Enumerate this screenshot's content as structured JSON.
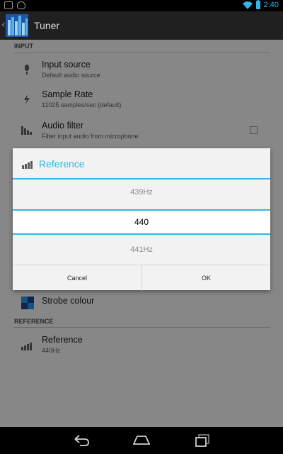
{
  "status_bar": {
    "time": "2:40",
    "icons": [
      "image-icon",
      "cat-notification-icon",
      "wifi-icon",
      "battery-icon"
    ]
  },
  "action_bar": {
    "title": "Tuner",
    "icons": [
      "back-chevron-icon",
      "app-logo-icon"
    ]
  },
  "settings": {
    "section_input": "INPUT",
    "input_source": {
      "title": "Input source",
      "summary": "Default audio source"
    },
    "sample_rate": {
      "title": "Sample Rate",
      "summary": "11025 samples/sec (default)"
    },
    "audio_filter": {
      "title": "Audio filter",
      "summary": "Filter input audio from microphone",
      "checked": false
    },
    "strobe_colour": {
      "title": "Strobe colour"
    },
    "section_reference": "REFERENCE",
    "reference": {
      "title": "Reference",
      "summary": "440Hz"
    }
  },
  "dialog": {
    "title": "Reference",
    "picker_prev": "439Hz",
    "picker_current": "440",
    "picker_next": "441Hz",
    "cancel_label": "Cancel",
    "ok_label": "OK"
  },
  "nav_bar": {
    "icons": [
      "back-icon",
      "home-icon",
      "recent-apps-icon"
    ]
  },
  "colors": {
    "accent": "#33b5e5",
    "statusbar": "#000000",
    "actionbar": "#202020"
  }
}
